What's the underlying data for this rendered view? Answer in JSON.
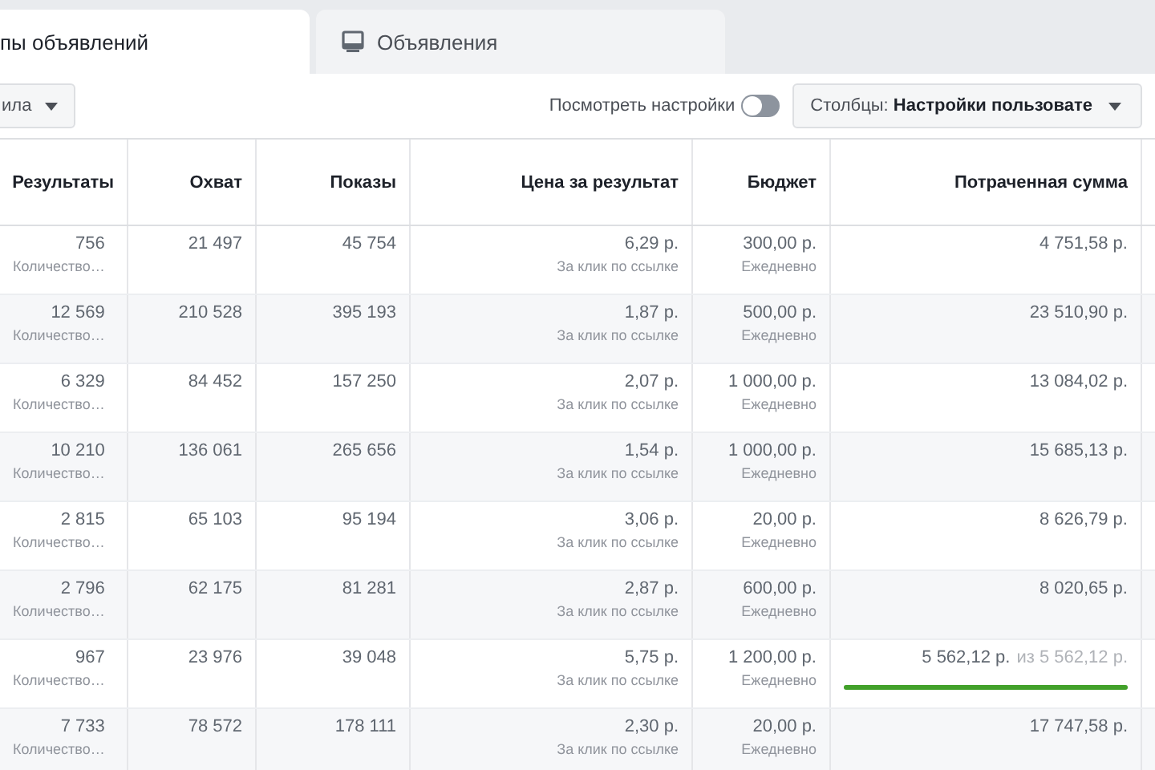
{
  "tabs": [
    {
      "label": "пы объявлений",
      "selected": true
    },
    {
      "label": "Объявления",
      "selected": false
    }
  ],
  "toolbar": {
    "filter_dropdown": "ила",
    "view_settings": {
      "label": "Посмотреть настройки",
      "on": false
    },
    "columns_button": {
      "prefix": "Столбцы:",
      "value": "Настройки пользовате"
    }
  },
  "table": {
    "columns": [
      "Результаты",
      "Охват",
      "Показы",
      "Цена за результат",
      "Бюджет",
      "Потраченная сумма"
    ],
    "rows": [
      {
        "results": "756",
        "results_sub": "Количество…",
        "reach": "21 497",
        "impressions": "45 754",
        "cost": "6,29 р.",
        "cost_sub": "За клик по ссылке",
        "budget": "300,00 р.",
        "budget_sub": "Ежедневно",
        "spent": "4 751,58 р."
      },
      {
        "results": "12 569",
        "results_sub": "Количество…",
        "reach": "210 528",
        "impressions": "395 193",
        "cost": "1,87 р.",
        "cost_sub": "За клик по ссылке",
        "budget": "500,00 р.",
        "budget_sub": "Ежедневно",
        "spent": "23 510,90 р."
      },
      {
        "results": "6 329",
        "results_sub": "Количество…",
        "reach": "84 452",
        "impressions": "157 250",
        "cost": "2,07 р.",
        "cost_sub": "За клик по ссылке",
        "budget": "1 000,00 р.",
        "budget_sub": "Ежедневно",
        "spent": "13 084,02 р."
      },
      {
        "results": "10 210",
        "results_sub": "Количество…",
        "reach": "136 061",
        "impressions": "265 656",
        "cost": "1,54 р.",
        "cost_sub": "За клик по ссылке",
        "budget": "1 000,00 р.",
        "budget_sub": "Ежедневно",
        "spent": "15 685,13 р."
      },
      {
        "results": "2 815",
        "results_sub": "Количество…",
        "reach": "65 103",
        "impressions": "95 194",
        "cost": "3,06 р.",
        "cost_sub": "За клик по ссылке",
        "budget": "20,00 р.",
        "budget_sub": "Ежедневно",
        "spent": "8 626,79 р."
      },
      {
        "results": "2 796",
        "results_sub": "Количество…",
        "reach": "62 175",
        "impressions": "81 281",
        "cost": "2,87 р.",
        "cost_sub": "За клик по ссылке",
        "budget": "600,00 р.",
        "budget_sub": "Ежедневно",
        "spent": "8 020,65 р."
      },
      {
        "results": "967",
        "results_sub": "Количество…",
        "reach": "23 976",
        "impressions": "39 048",
        "cost": "5,75 р.",
        "cost_sub": "За клик по ссылке",
        "budget": "1 200,00 р.",
        "budget_sub": "Ежедневно",
        "spent": "5 562,12 р.",
        "spent_limit": "из 5 562,12 р.",
        "level": 1
      },
      {
        "results": "7 733",
        "results_sub": "Количество…",
        "reach": "78 572",
        "impressions": "178 111",
        "cost": "2,30 р.",
        "cost_sub": "За клик по ссылке",
        "budget": "20,00 р.",
        "budget_sub": "Ежедневно",
        "spent": "17 747,58 р."
      }
    ]
  }
}
